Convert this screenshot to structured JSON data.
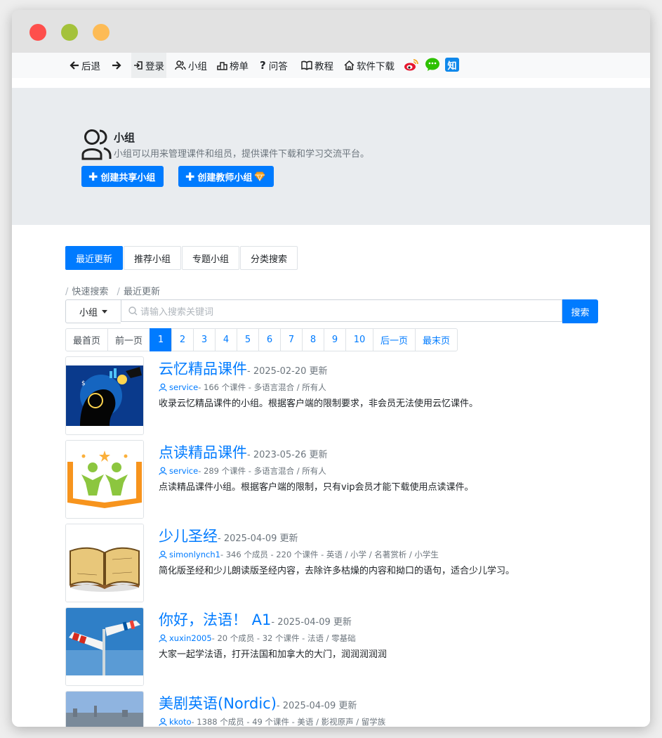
{
  "nav": {
    "back": "后退",
    "login": "登录",
    "groups": "小组",
    "ranking": "榜单",
    "qa": "问答",
    "tutorial": "教程",
    "download": "软件下载",
    "zhihu": "知"
  },
  "hero": {
    "title": "小组",
    "description": "小组可以用来管理课件和组员，提供课件下载和学习交流平台。",
    "create_shared": "创建共享小组",
    "create_teacher": "创建教师小组"
  },
  "tabs": [
    "最近更新",
    "推荐小组",
    "专题小组",
    "分类搜索"
  ],
  "breadcrumb": [
    "快速搜索",
    "最近更新"
  ],
  "search": {
    "scope": "小组",
    "placeholder": "请输入搜索关键词",
    "button": "搜索"
  },
  "pagination": {
    "first": "最首页",
    "prev": "前一页",
    "pages": [
      "1",
      "2",
      "3",
      "4",
      "5",
      "6",
      "7",
      "8",
      "9",
      "10"
    ],
    "current": "1",
    "next": "后一页",
    "last": "最末页"
  },
  "groups": [
    {
      "title": "云忆精品课件",
      "date": "- 2025-02-20 更新",
      "user": "service",
      "meta": " - 166 个课件 - 多语言混合 / 所有人",
      "desc": "收录云忆精品课件的小组。根据客户端的限制要求，非会员无法使用云忆课件。"
    },
    {
      "title": "点读精品课件",
      "date": "- 2023-05-26 更新",
      "user": "service",
      "meta": " - 289 个课件 - 多语言混合 / 所有人",
      "desc": "点读精品课件小组。根据客户端的限制，只有vip会员才能下载使用点读课件。"
    },
    {
      "title": "少儿圣经",
      "date": "- 2025-04-09 更新",
      "user": "simonlynch1",
      "meta": "- 346 个成员 - 220 个课件 - 英语 / 小学 / 名著赏析 / 小学生",
      "desc": "简化版圣经和少儿朗读版圣经内容，去除许多枯燥的内容和拗口的语句，适合少儿学习。"
    },
    {
      "title": "你好，法语！ A1",
      "date": "- 2025-04-09 更新",
      "user": "xuxin2005",
      "meta": "- 20 个成员 - 32 个课件 - 法语 / 零基础",
      "desc": "大家一起学法语，打开法国和加拿大的大门，润润润润润"
    },
    {
      "title": "美剧英语(Nordic)",
      "date": "- 2025-04-09 更新",
      "user": "kkoto",
      "meta": "- 1388 个成员 - 49 个课件 - 美语 / 影视原声 / 留学族",
      "desc": ""
    }
  ],
  "colors": {
    "primary": "#007bff",
    "hero_bg": "#e9ecef",
    "muted": "#6c757d"
  }
}
